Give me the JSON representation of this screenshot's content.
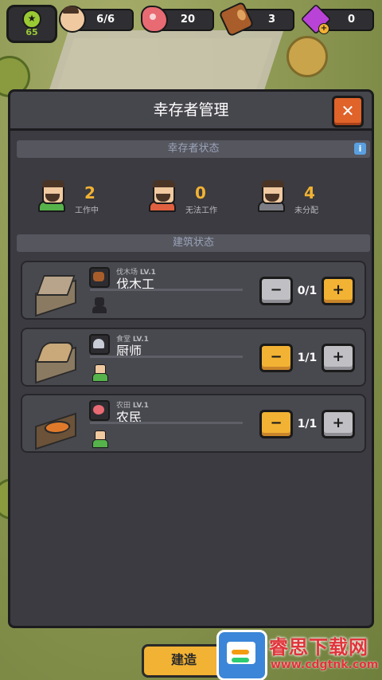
{
  "hud": {
    "level": "65",
    "survivors": "6/6",
    "meat": "20",
    "wood": "3",
    "gems": "0"
  },
  "panel": {
    "title": "幸存者管理",
    "close_label": "✕",
    "survivor_status_header": "幸存者状态",
    "building_status_header": "建筑状态",
    "info_icon": "i"
  },
  "stats": [
    {
      "value": "2",
      "label": "工作中",
      "color": "#56b24a"
    },
    {
      "value": "0",
      "label": "无法工作",
      "color": "#e06040"
    },
    {
      "value": "4",
      "label": "未分配",
      "color": "#7d7d85"
    }
  ],
  "buildings": [
    {
      "sub_name": "伐木场",
      "level": "LV.1",
      "role": "伐木工",
      "count": "0/1",
      "minus": "−",
      "plus": "+"
    },
    {
      "sub_name": "食堂",
      "level": "LV.1",
      "role": "厨师",
      "count": "1/1",
      "minus": "−",
      "plus": "+"
    },
    {
      "sub_name": "农田",
      "level": "LV.1",
      "role": "农民",
      "count": "1/1",
      "minus": "−",
      "plus": "+"
    }
  ],
  "background": {
    "bottom_button": "建造",
    "watermark_title": "睿思下载网",
    "watermark_url": "www.cdgtnk.com"
  }
}
